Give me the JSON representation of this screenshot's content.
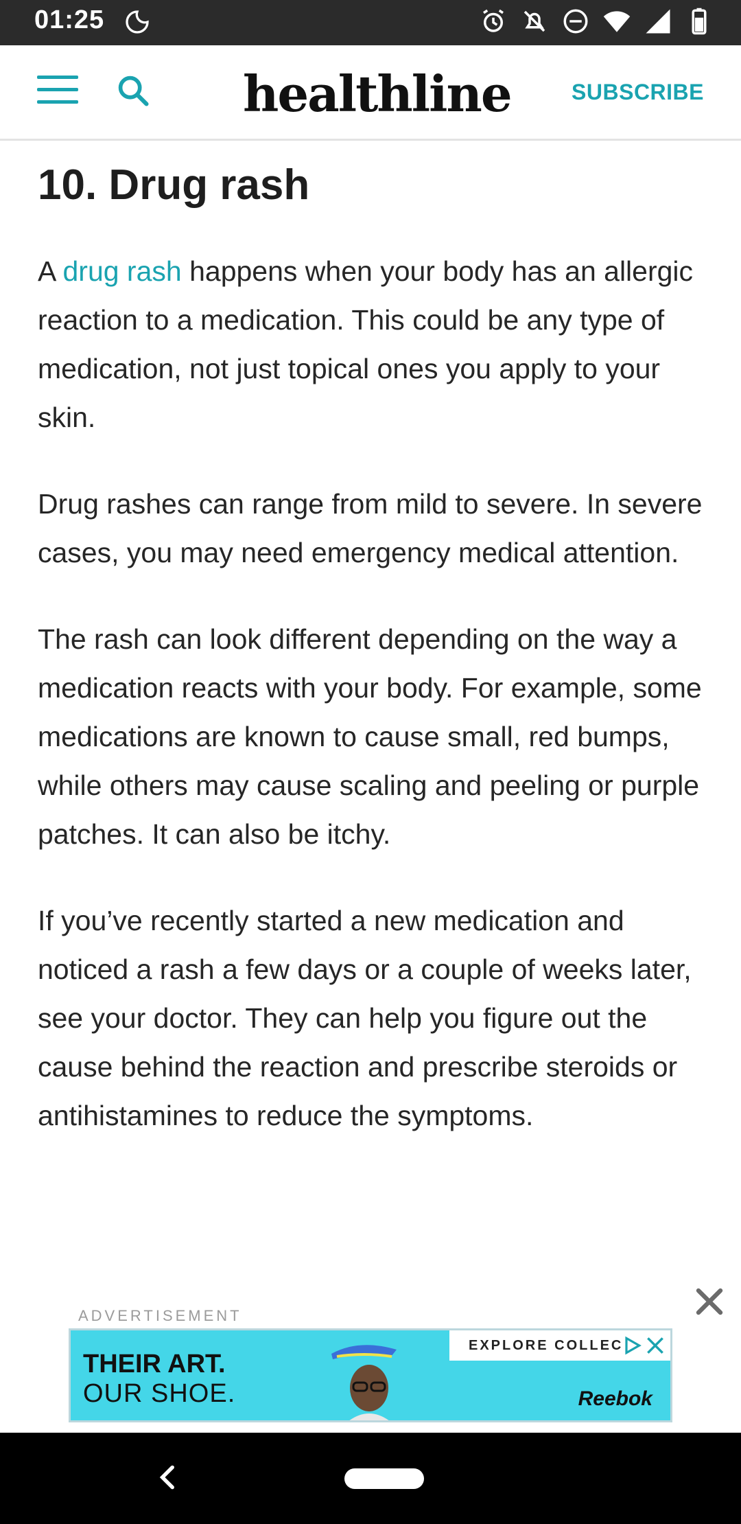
{
  "status_bar": {
    "time": "01:25",
    "icons": [
      "bedtime-icon",
      "alarm-icon",
      "notifications-off-icon",
      "do-not-disturb-icon",
      "wifi-icon",
      "signal-icon",
      "battery-icon"
    ]
  },
  "header": {
    "logo": "healthline",
    "subscribe_label": "SUBSCRIBE",
    "accent_color": "#1aa3b0"
  },
  "article": {
    "heading": "10. Drug rash",
    "p1_prefix": "A ",
    "p1_link": "drug rash",
    "p1_suffix": " happens when your body has an allergic reaction to a medication. This could be any type of medication, not just topical ones you apply to your skin.",
    "p2": "Drug rashes can range from mild to severe. In severe cases, you may need emergency medical attention.",
    "p3": "The rash can look different depending on the way a medication reacts with your body. For example, some medications are known to cause small, red bumps, while others may cause scaling and peeling or purple patches. It can also be itchy.",
    "p4": "If you’ve recently started a new medication and noticed a rash a few days or a couple of weeks later, see your doctor. They can help you figure out the cause behind the reaction and prescribe steroids or antihistamines to reduce the symptoms."
  },
  "ad": {
    "label": "ADVERTISEMENT",
    "headline_line1": "THEIR ART.",
    "headline_line2": "OUR SHOE.",
    "cta": "EXPLORE COLLEC",
    "brand": "Reebok",
    "background_color": "#44d6e8"
  },
  "nav_bar": {
    "icons": [
      "back-icon",
      "home-pill"
    ]
  }
}
